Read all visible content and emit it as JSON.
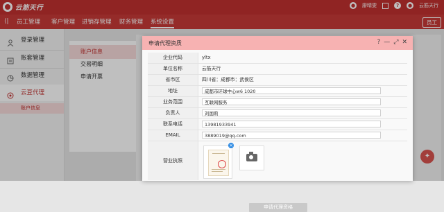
{
  "header": {
    "logo_text": "云筋天行",
    "user_name": "廖晴雯",
    "right_brand": "云筋天行"
  },
  "nav": {
    "items": [
      {
        "label": "员工管理"
      },
      {
        "label": "客户管理"
      },
      {
        "label": "进销存管理"
      },
      {
        "label": "财务管理"
      },
      {
        "label": "系统设置"
      }
    ],
    "badge": "员工"
  },
  "sidebar": {
    "items": [
      {
        "label": "登录管理",
        "icon": "user-icon"
      },
      {
        "label": "账套管理",
        "icon": "ledger-icon"
      },
      {
        "label": "数据管理",
        "icon": "pie-chart-icon"
      },
      {
        "label": "云豆代理",
        "icon": "agent-icon"
      }
    ],
    "sub_item": "账户信息"
  },
  "midpanel": {
    "items": [
      {
        "label": "账户信息"
      },
      {
        "label": "交易明细"
      },
      {
        "label": "申请开票"
      }
    ]
  },
  "modal": {
    "title": "申请代理资质",
    "fields": [
      {
        "label": "企业代码",
        "value": "yltx"
      },
      {
        "label": "单位名称",
        "value": "云筋天行"
      },
      {
        "label": "省市区",
        "value": "四川省：成都市：武侯区"
      },
      {
        "label": "地址",
        "value": "成都市环球中心w6 1020"
      },
      {
        "label": "业务范围",
        "value": "互联网服务"
      },
      {
        "label": "负责人",
        "value": "刘国莉"
      },
      {
        "label": "联系电话",
        "value": "13981933941"
      },
      {
        "label": "EMAIL",
        "value": "3889019@qq.com"
      }
    ],
    "license_label": "营业执照",
    "submit_label": "申请代理资格"
  },
  "colors": {
    "brand": "#c0302f",
    "modal_header": "#f7b2b2",
    "active_bg": "#f6dada"
  }
}
